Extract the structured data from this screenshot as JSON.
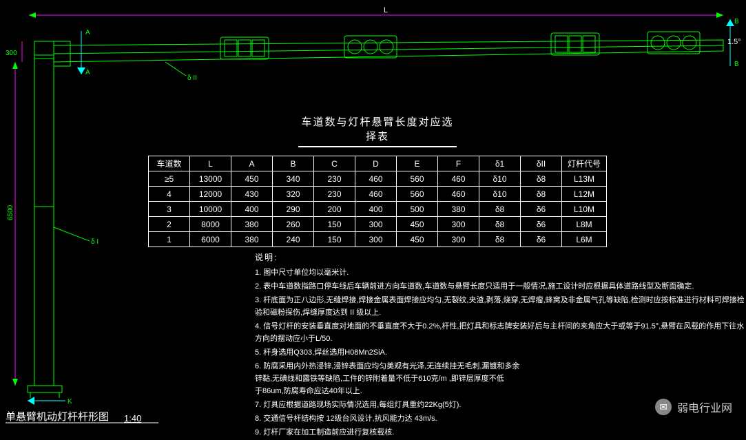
{
  "drawing": {
    "title": "单悬臂机动灯杆杆形图",
    "scale": "1:40",
    "pole_height": "6500",
    "arm_connection": "300",
    "arm_length_label": "L",
    "arm_angle": "1.5°",
    "section_A": "A",
    "section_B": "B",
    "section_K": "K",
    "taper_labels": {
      "delta1": "δ I",
      "delta2": "δ II"
    }
  },
  "table": {
    "title": "车道数与灯杆悬臂长度对应选择表",
    "headers": [
      "车道数",
      "L",
      "A",
      "B",
      "C",
      "D",
      "E",
      "F",
      "δ1",
      "δII",
      "灯杆代号"
    ],
    "rows": [
      [
        "≥5",
        "13000",
        "450",
        "340",
        "230",
        "460",
        "560",
        "460",
        "δ10",
        "δ8",
        "L13M"
      ],
      [
        "4",
        "12000",
        "430",
        "320",
        "230",
        "460",
        "560",
        "460",
        "δ10",
        "δ8",
        "L12M"
      ],
      [
        "3",
        "10000",
        "400",
        "290",
        "200",
        "400",
        "500",
        "380",
        "δ8",
        "δ6",
        "L10M"
      ],
      [
        "2",
        "8000",
        "380",
        "260",
        "150",
        "300",
        "450",
        "300",
        "δ8",
        "δ6",
        "L8M"
      ],
      [
        "1",
        "6000",
        "380",
        "240",
        "150",
        "300",
        "450",
        "300",
        "δ8",
        "δ6",
        "L6M"
      ]
    ]
  },
  "notes": {
    "title": "说明:",
    "items": [
      "1. 图中尺寸单位均以毫米计.",
      "2. 表中车道数指路口停车线后车辆前进方向车道数,车道数与悬臂长度只适用于一般情况,施工设计时应根据具体道路线型及断面确定.",
      "3. 杆底面为正八边形,无缝焊接,焊接金属表面焊接应均匀,无裂纹,夹渣,剥落,烧穿,无焊瘤,蜂窝及非金属气孔等缺陷,检测时应按标准进行材料可焊接检验和磁粉探伤,焊缝厚度达到 II 级以上.",
      "4. 信号灯杆的安装垂直度对地面的不垂直度不大于0.2%,杆性,把灯具和标志牌安装好后与主杆间的夹角应大于或等于91.5°,悬臂在风载的作用下往水方向的摆动应小于L/50.",
      "5. 杆身选用Q303,焊丝选用H08Mn2SiA.",
      "6. 防腐采用内外热浸锌,浸锌表面应均匀美观有光泽,无连续挂无毛刺,漏镀和多余\n   锌黏,无碘线和露铁等缺陷,工件的锌附着量不低于610克/m ,即锌层厚度不低\n   于86um,防腐寿命应达40年以上.",
      "7. 灯具应根据道路现场实际情况选用,每组灯具重约22Kg(5灯).",
      "8. 交通信号杆结构按 12级台风设计,抗风能力达 43m/s.",
      "9. 灯杆厂家在加工制造前应进行复核载核."
    ]
  },
  "watermark": "弱电行业网",
  "chart_data": {
    "type": "table",
    "title": "车道数与灯杆悬臂长度对应选择表",
    "columns": [
      "车道数",
      "L",
      "A",
      "B",
      "C",
      "D",
      "E",
      "F",
      "δ1",
      "δII",
      "灯杆代号"
    ],
    "data": [
      {
        "车道数": "≥5",
        "L": 13000,
        "A": 450,
        "B": 340,
        "C": 230,
        "D": 460,
        "E": 560,
        "F": 460,
        "δ1": "δ10",
        "δII": "δ8",
        "灯杆代号": "L13M"
      },
      {
        "车道数": "4",
        "L": 12000,
        "A": 430,
        "B": 320,
        "C": 230,
        "D": 460,
        "E": 560,
        "F": 460,
        "δ1": "δ10",
        "δII": "δ8",
        "灯杆代号": "L12M"
      },
      {
        "车道数": "3",
        "L": 10000,
        "A": 400,
        "B": 290,
        "C": 200,
        "D": 400,
        "E": 500,
        "F": 380,
        "δ1": "δ8",
        "δII": "δ6",
        "灯杆代号": "L10M"
      },
      {
        "车道数": "2",
        "L": 8000,
        "A": 380,
        "B": 260,
        "C": 150,
        "D": 300,
        "E": 450,
        "F": 300,
        "δ1": "δ8",
        "δII": "δ6",
        "灯杆代号": "L8M"
      },
      {
        "车道数": "1",
        "L": 6000,
        "A": 380,
        "B": 240,
        "C": 150,
        "D": 300,
        "E": 450,
        "F": 300,
        "δ1": "δ8",
        "δII": "δ6",
        "灯杆代号": "L6M"
      }
    ]
  }
}
